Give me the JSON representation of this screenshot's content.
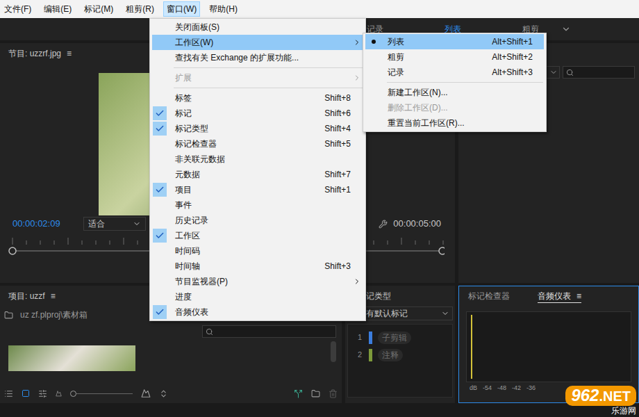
{
  "menu_bar": {
    "items": [
      {
        "label": "文件(F)",
        "selected": false
      },
      {
        "label": "编辑(E)",
        "selected": false
      },
      {
        "label": "标记(M)",
        "selected": false
      },
      {
        "label": "粗剪(R)",
        "selected": false
      },
      {
        "label": "窗口(W)",
        "selected": true
      },
      {
        "label": "帮助(H)",
        "selected": false
      }
    ]
  },
  "workspace_bar": {
    "tabs": [
      {
        "label": "记录",
        "selected": false
      },
      {
        "label": "列表",
        "selected": true
      },
      {
        "label": "粗剪",
        "selected": false
      }
    ]
  },
  "program_monitor": {
    "title": "节目: uzzrf.jpg",
    "menu_icon": "≡",
    "timecode": "00:00:02:09",
    "zoom": "适合",
    "duration": "00:00:05:00"
  },
  "project_panel": {
    "title": "项目: uzzf",
    "menu_icon": "≡",
    "path": "uz zf.plproj\\素材箱"
  },
  "marker_types_panel": {
    "title": "记类型",
    "dropdown": "有默认标记",
    "items": [
      {
        "index": "1",
        "label": "子剪辑",
        "color": "#3b7ddd"
      },
      {
        "index": "2",
        "label": "注释",
        "color": "#7d9a3a"
      }
    ]
  },
  "audio_panel": {
    "tabs": [
      {
        "label": "标记检查器",
        "selected": false
      },
      {
        "label": "音频仪表",
        "selected": true
      }
    ],
    "menu_icon": "≡",
    "scale": [
      "dB",
      "-54",
      "-48",
      "-42",
      "-36"
    ]
  },
  "window_menu": {
    "items": [
      {
        "kind": "item",
        "label": "关闭面板(S)",
        "shortcut": "",
        "checked": false,
        "disabled": false,
        "highlighted": false,
        "submenu": false
      },
      {
        "kind": "item",
        "label": "工作区(W)",
        "shortcut": "",
        "checked": false,
        "disabled": false,
        "highlighted": true,
        "submenu": true
      },
      {
        "kind": "item",
        "label": "查找有关 Exchange 的扩展功能...",
        "shortcut": "",
        "checked": false,
        "disabled": false,
        "highlighted": false,
        "submenu": false
      },
      {
        "kind": "separator"
      },
      {
        "kind": "item",
        "label": "扩展",
        "shortcut": "",
        "checked": false,
        "disabled": true,
        "highlighted": false,
        "submenu": true
      },
      {
        "kind": "separator"
      },
      {
        "kind": "item",
        "label": "标签",
        "shortcut": "Shift+8",
        "checked": false,
        "disabled": false,
        "highlighted": false,
        "submenu": false
      },
      {
        "kind": "item",
        "label": "标记",
        "shortcut": "Shift+6",
        "checked": true,
        "disabled": false,
        "highlighted": false,
        "submenu": false
      },
      {
        "kind": "item",
        "label": "标记类型",
        "shortcut": "Shift+4",
        "checked": true,
        "disabled": false,
        "highlighted": false,
        "submenu": false
      },
      {
        "kind": "item",
        "label": "标记检查器",
        "shortcut": "Shift+5",
        "checked": false,
        "disabled": false,
        "highlighted": false,
        "submenu": false
      },
      {
        "kind": "item",
        "label": "非关联元数据",
        "shortcut": "",
        "checked": false,
        "disabled": false,
        "highlighted": false,
        "submenu": false
      },
      {
        "kind": "item",
        "label": "元数据",
        "shortcut": "Shift+7",
        "checked": false,
        "disabled": false,
        "highlighted": false,
        "submenu": false
      },
      {
        "kind": "item",
        "label": "项目",
        "shortcut": "Shift+1",
        "checked": true,
        "disabled": false,
        "highlighted": false,
        "submenu": false
      },
      {
        "kind": "item",
        "label": "事件",
        "shortcut": "",
        "checked": false,
        "disabled": false,
        "highlighted": false,
        "submenu": false
      },
      {
        "kind": "item",
        "label": "历史记录",
        "shortcut": "",
        "checked": false,
        "disabled": false,
        "highlighted": false,
        "submenu": false
      },
      {
        "kind": "item",
        "label": "工作区",
        "shortcut": "",
        "checked": true,
        "disabled": false,
        "highlighted": false,
        "submenu": false
      },
      {
        "kind": "item",
        "label": "时间码",
        "shortcut": "",
        "checked": false,
        "disabled": false,
        "highlighted": false,
        "submenu": false
      },
      {
        "kind": "item",
        "label": "时间轴",
        "shortcut": "Shift+3",
        "checked": false,
        "disabled": false,
        "highlighted": false,
        "submenu": false
      },
      {
        "kind": "item",
        "label": "节目监视器(P)",
        "shortcut": "",
        "checked": false,
        "disabled": false,
        "highlighted": false,
        "submenu": true
      },
      {
        "kind": "item",
        "label": "进度",
        "shortcut": "",
        "checked": false,
        "disabled": false,
        "highlighted": false,
        "submenu": false
      },
      {
        "kind": "item",
        "label": "音频仪表",
        "shortcut": "",
        "checked": true,
        "disabled": false,
        "highlighted": false,
        "submenu": false
      }
    ]
  },
  "workspace_submenu": {
    "items": [
      {
        "kind": "item",
        "label": "列表",
        "shortcut": "Alt+Shift+1",
        "selected": true,
        "highlighted": true,
        "disabled": false
      },
      {
        "kind": "item",
        "label": "粗剪",
        "shortcut": "Alt+Shift+2",
        "selected": false,
        "highlighted": false,
        "disabled": false
      },
      {
        "kind": "item",
        "label": "记录",
        "shortcut": "Alt+Shift+3",
        "selected": false,
        "highlighted": false,
        "disabled": false
      },
      {
        "kind": "separator"
      },
      {
        "kind": "item",
        "label": "新建工作区(N)...",
        "shortcut": "",
        "selected": false,
        "highlighted": false,
        "disabled": false
      },
      {
        "kind": "item",
        "label": "删除工作区(D)...",
        "shortcut": "",
        "selected": false,
        "highlighted": false,
        "disabled": true
      },
      {
        "kind": "item",
        "label": "重置当前工作区(R)...",
        "shortcut": "",
        "selected": false,
        "highlighted": false,
        "disabled": false
      }
    ]
  },
  "watermark": {
    "number": "962",
    "suffix": ".NET",
    "caption": "乐游网"
  }
}
